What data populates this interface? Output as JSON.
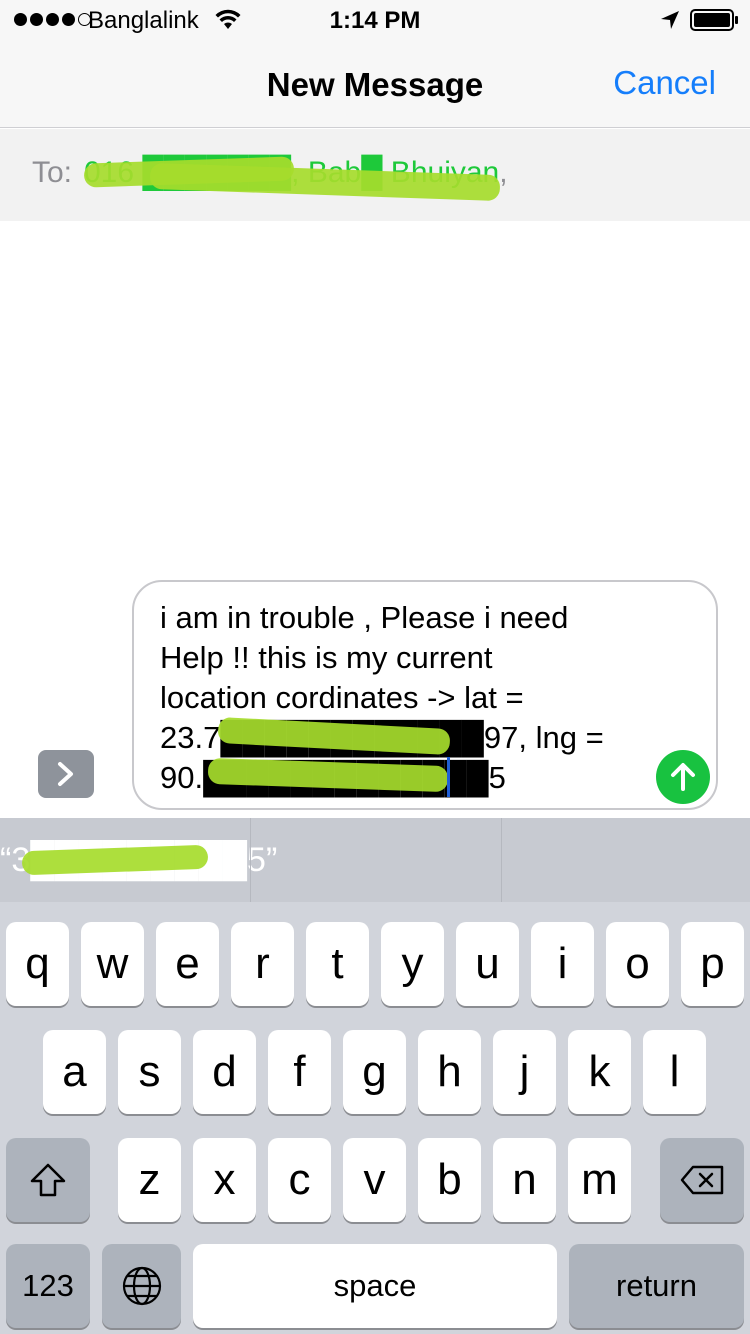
{
  "status_bar": {
    "carrier": "Banglalink",
    "time": "1:14 PM"
  },
  "nav": {
    "title": "New Message",
    "cancel_label": "Cancel"
  },
  "to_field": {
    "label": "To:",
    "recipients_text": "016 ███████, Bab█ Bhuiyan",
    "trailing_comma": ","
  },
  "message": {
    "text": "i am in trouble , Please i need\nHelp !! this is my current\nlocation cordinates -> lat =\n23.7████████████97, lng =\n90.█████████████5"
  },
  "keyboard": {
    "suggestions": [
      "“3█████████5”",
      "",
      ""
    ],
    "row1": [
      "q",
      "w",
      "e",
      "r",
      "t",
      "y",
      "u",
      "i",
      "o",
      "p"
    ],
    "row2": [
      "a",
      "s",
      "d",
      "f",
      "g",
      "h",
      "j",
      "k",
      "l"
    ],
    "row3": [
      "z",
      "x",
      "c",
      "v",
      "b",
      "n",
      "m"
    ],
    "numbers_label": "123",
    "space_label": "space",
    "return_label": "return"
  },
  "colors": {
    "accent_blue": "#157efb",
    "send_green": "#18c240",
    "recipient_green": "#1ec93a",
    "redaction_highlight": "#a6dc2c"
  }
}
